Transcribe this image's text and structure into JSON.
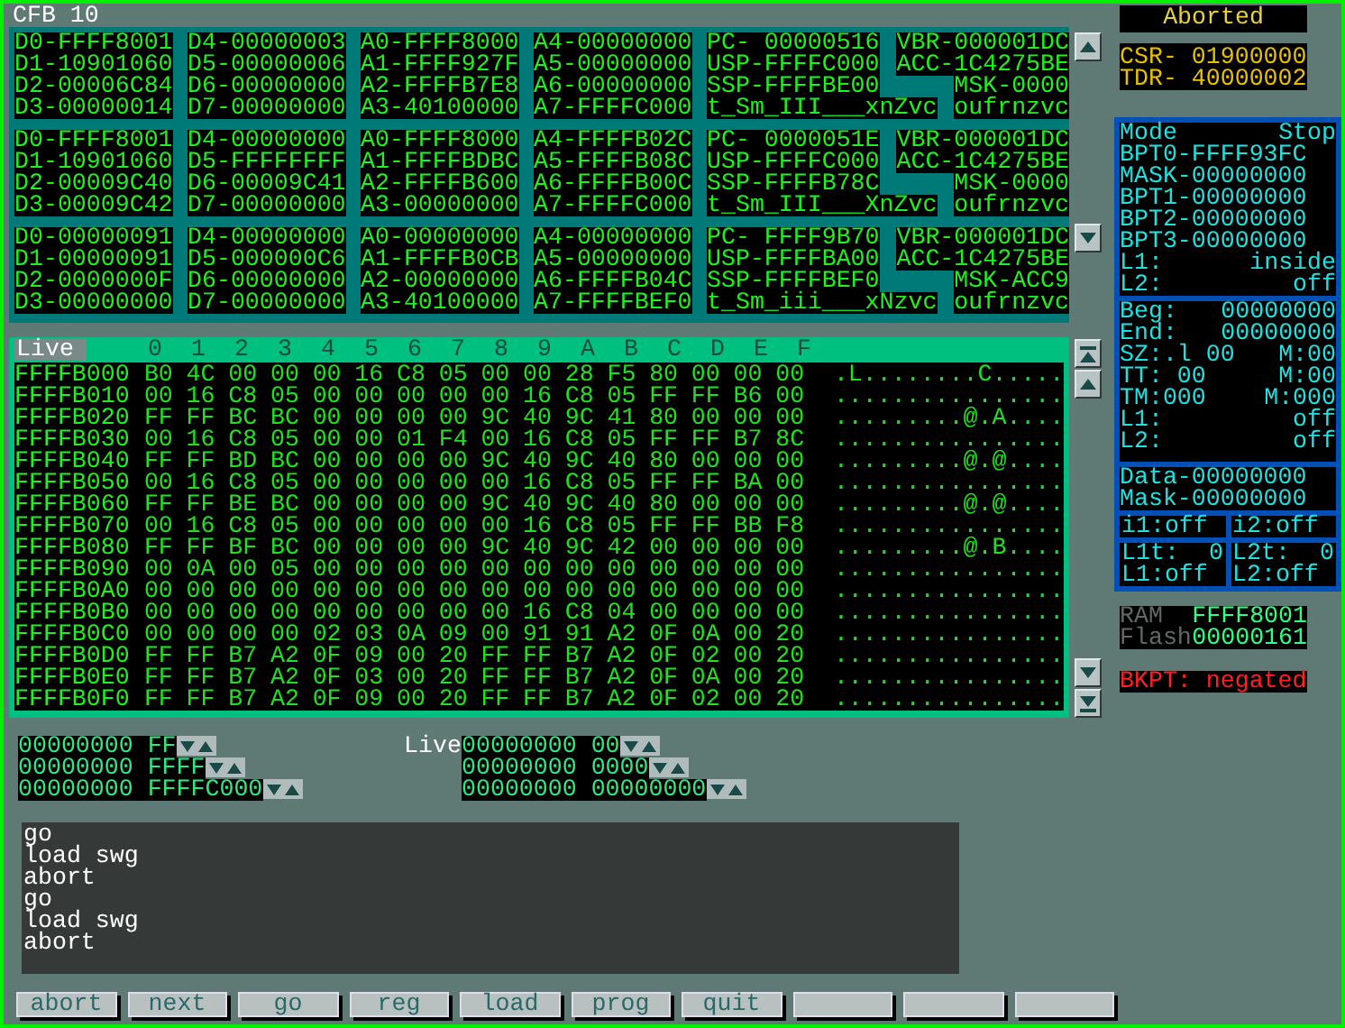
{
  "window": {
    "title": "CFB 10"
  },
  "register_sets": [
    {
      "blocks": [
        [
          "D0-FFFF8001",
          "D1-10901060",
          "D2-00006C84",
          "D3-00000014"
        ],
        [
          "D4-00000003",
          "D5-00000006",
          "D6-00000000",
          "D7-00000000"
        ],
        [
          "A0-FFFF8000",
          "A1-FFFF927F",
          "A2-FFFFB7E8",
          "A3-40100000"
        ],
        [
          "A4-00000000",
          "A5-00000000",
          "A6-00000000",
          "A7-FFFFC000"
        ],
        [
          "PC- 00000516",
          "USP-FFFFC000",
          "SSP-FFFFBE00",
          "t_Sm_III___xnZvc"
        ],
        [
          "VBR-000001DC",
          "ACC-1C4275BE",
          "MSK-0000",
          "oufrnzvc"
        ]
      ]
    },
    {
      "blocks": [
        [
          "D0-FFFF8001",
          "D1-10901060",
          "D2-00009C40",
          "D3-00009C42"
        ],
        [
          "D4-00000000",
          "D5-FFFFFFFF",
          "D6-00009C41",
          "D7-00000000"
        ],
        [
          "A0-FFFF8000",
          "A1-FFFFBDBC",
          "A2-FFFFB600",
          "A3-00000000"
        ],
        [
          "A4-FFFFB02C",
          "A5-FFFFB08C",
          "A6-FFFFB00C",
          "A7-FFFFC000"
        ],
        [
          "PC- 0000051E",
          "USP-FFFFC000",
          "SSP-FFFFB78C",
          "t_Sm_III___XnZvc"
        ],
        [
          "VBR-000001DC",
          "ACC-1C4275BE",
          "MSK-0000",
          "oufrnzvc"
        ]
      ]
    },
    {
      "blocks": [
        [
          "D0-00000091",
          "D1-00000091",
          "D2-0000000F",
          "D3-00000000"
        ],
        [
          "D4-00000000",
          "D5-000000C6",
          "D6-00000000",
          "D7-00000000"
        ],
        [
          "A0-00000000",
          "A1-FFFFB0CB",
          "A2-00000000",
          "A3-40100000"
        ],
        [
          "A4-00000000",
          "A5-00000000",
          "A6-FFFFB04C",
          "A7-FFFFBEF0"
        ],
        [
          "PC- FFFF9B70",
          "USP-FFFFBA00",
          "SSP-FFFFBEF0",
          "t_Sm_iii___xNzvc"
        ],
        [
          "VBR-000001DC",
          "ACC-1C4275BE",
          "MSK-ACC9",
          "oufrnzvc"
        ]
      ]
    }
  ],
  "memory": {
    "mode": "Live",
    "columns": [
      "0",
      "1",
      "2",
      "3",
      "4",
      "5",
      "6",
      "7",
      "8",
      "9",
      "A",
      "B",
      "C",
      "D",
      "E",
      "F"
    ],
    "rows": [
      {
        "address": "FFFFB000",
        "bytes": [
          "B0",
          "4C",
          "00",
          "00",
          "00",
          "16",
          "C8",
          "05",
          "00",
          "00",
          "28",
          "F5",
          "80",
          "00",
          "00",
          "00"
        ],
        "ascii": ".L........C....."
      },
      {
        "address": "FFFFB010",
        "bytes": [
          "00",
          "16",
          "C8",
          "05",
          "00",
          "00",
          "00",
          "00",
          "00",
          "16",
          "C8",
          "05",
          "FF",
          "FF",
          "B6",
          "00"
        ],
        "ascii": "................"
      },
      {
        "address": "FFFFB020",
        "bytes": [
          "FF",
          "FF",
          "BC",
          "BC",
          "00",
          "00",
          "00",
          "00",
          "9C",
          "40",
          "9C",
          "41",
          "80",
          "00",
          "00",
          "00"
        ],
        "ascii": ".........@.A...."
      },
      {
        "address": "FFFFB030",
        "bytes": [
          "00",
          "16",
          "C8",
          "05",
          "00",
          "00",
          "01",
          "F4",
          "00",
          "16",
          "C8",
          "05",
          "FF",
          "FF",
          "B7",
          "8C"
        ],
        "ascii": "................"
      },
      {
        "address": "FFFFB040",
        "bytes": [
          "FF",
          "FF",
          "BD",
          "BC",
          "00",
          "00",
          "00",
          "00",
          "9C",
          "40",
          "9C",
          "40",
          "80",
          "00",
          "00",
          "00"
        ],
        "ascii": ".........@.@...."
      },
      {
        "address": "FFFFB050",
        "bytes": [
          "00",
          "16",
          "C8",
          "05",
          "00",
          "00",
          "00",
          "00",
          "00",
          "16",
          "C8",
          "05",
          "FF",
          "FF",
          "BA",
          "00"
        ],
        "ascii": "................"
      },
      {
        "address": "FFFFB060",
        "bytes": [
          "FF",
          "FF",
          "BE",
          "BC",
          "00",
          "00",
          "00",
          "00",
          "9C",
          "40",
          "9C",
          "40",
          "80",
          "00",
          "00",
          "00"
        ],
        "ascii": ".........@.@...."
      },
      {
        "address": "FFFFB070",
        "bytes": [
          "00",
          "16",
          "C8",
          "05",
          "00",
          "00",
          "00",
          "00",
          "00",
          "16",
          "C8",
          "05",
          "FF",
          "FF",
          "BB",
          "F8"
        ],
        "ascii": "................"
      },
      {
        "address": "FFFFB080",
        "bytes": [
          "FF",
          "FF",
          "BF",
          "BC",
          "00",
          "00",
          "00",
          "00",
          "9C",
          "40",
          "9C",
          "42",
          "00",
          "00",
          "00",
          "00"
        ],
        "ascii": ".........@.B...."
      },
      {
        "address": "FFFFB090",
        "bytes": [
          "00",
          "0A",
          "00",
          "05",
          "00",
          "00",
          "00",
          "00",
          "00",
          "00",
          "00",
          "00",
          "00",
          "00",
          "00",
          "00"
        ],
        "ascii": "................"
      },
      {
        "address": "FFFFB0A0",
        "bytes": [
          "00",
          "00",
          "00",
          "00",
          "00",
          "00",
          "00",
          "00",
          "00",
          "00",
          "00",
          "00",
          "00",
          "00",
          "00",
          "00"
        ],
        "ascii": "................"
      },
      {
        "address": "FFFFB0B0",
        "bytes": [
          "00",
          "00",
          "00",
          "00",
          "00",
          "00",
          "00",
          "00",
          "00",
          "16",
          "C8",
          "04",
          "00",
          "00",
          "00",
          "00"
        ],
        "ascii": "................"
      },
      {
        "address": "FFFFB0C0",
        "bytes": [
          "00",
          "00",
          "00",
          "00",
          "02",
          "03",
          "0A",
          "09",
          "00",
          "91",
          "91",
          "A2",
          "0F",
          "0A",
          "00",
          "20"
        ],
        "ascii": "................"
      },
      {
        "address": "FFFFB0D0",
        "bytes": [
          "FF",
          "FF",
          "B7",
          "A2",
          "0F",
          "09",
          "00",
          "20",
          "FF",
          "FF",
          "B7",
          "A2",
          "0F",
          "02",
          "00",
          "20"
        ],
        "ascii": "................"
      },
      {
        "address": "FFFFB0E0",
        "bytes": [
          "FF",
          "FF",
          "B7",
          "A2",
          "0F",
          "03",
          "00",
          "20",
          "FF",
          "FF",
          "B7",
          "A2",
          "0F",
          "0A",
          "00",
          "20"
        ],
        "ascii": "................"
      },
      {
        "address": "FFFFB0F0",
        "bytes": [
          "FF",
          "FF",
          "B7",
          "A2",
          "0F",
          "09",
          "00",
          "20",
          "FF",
          "FF",
          "B7",
          "A2",
          "0F",
          "02",
          "00",
          "20"
        ],
        "ascii": "................"
      }
    ]
  },
  "watch_fields": [
    {
      "left": {
        "address": "00000000",
        "value": "FF"
      },
      "label": "Live",
      "right": {
        "address": "00000000",
        "value": "00"
      }
    },
    {
      "left": {
        "address": "00000000",
        "value": "FFFF"
      },
      "right": {
        "address": "00000000",
        "value": "0000"
      }
    },
    {
      "left": {
        "address": "00000000",
        "value": "FFFFC000"
      },
      "right": {
        "address": "00000000",
        "value": "00000000"
      }
    }
  ],
  "console": [
    "go",
    "load swg",
    "abort",
    "go",
    "load swg",
    "abort"
  ],
  "buttons": [
    {
      "kind": "command",
      "label": "abort"
    },
    {
      "kind": "command",
      "label": "next"
    },
    {
      "kind": "command",
      "label": "go"
    },
    {
      "kind": "command",
      "label": "reg"
    },
    {
      "kind": "command",
      "label": "load"
    },
    {
      "kind": "command",
      "label": "prog"
    },
    {
      "kind": "command",
      "label": "quit"
    },
    {
      "kind": "blank"
    },
    {
      "kind": "blank"
    },
    {
      "kind": "blank"
    }
  ],
  "status": "Aborted",
  "control_registers": [
    "CSR- 01900000",
    "TDR- 40000002"
  ],
  "breakpoints": {
    "mode_section": [
      [
        "Mode",
        "Stop"
      ],
      [
        "BPT0-FFFF93FC"
      ],
      [
        "MASK-00000000"
      ],
      [
        "BPT1-00000000"
      ],
      [
        "BPT2-00000000"
      ],
      [
        "BPT3-00000000"
      ],
      [
        "L1:",
        "inside"
      ],
      [
        "L2:",
        "off"
      ]
    ],
    "range_section": [
      [
        "Beg:",
        "00000000"
      ],
      [
        "End:",
        "00000000"
      ],
      [
        "SZ:.l 00",
        "M:00"
      ],
      [
        "TT: 00",
        "M:00"
      ],
      [
        "TM:000",
        "M:000"
      ],
      [
        "L1:",
        "off"
      ],
      [
        "L2:",
        "off"
      ]
    ],
    "data_section": [
      [
        "Data-00000000"
      ],
      [
        "Mask-00000000"
      ]
    ],
    "flag_cells": [
      [
        [
          "i1:off"
        ]
      ],
      [
        [
          "i2:off"
        ]
      ],
      [
        [
          "L1t:",
          "0"
        ],
        [
          "L1:off"
        ]
      ],
      [
        [
          "L2t:",
          "0"
        ],
        [
          "L2:off"
        ]
      ]
    ]
  },
  "memory_info": [
    {
      "label": "RAM",
      "value": "FFFF8001"
    },
    {
      "label": "Flash",
      "value": "00000161"
    }
  ],
  "bkpt_status": "BKPT: negated"
}
